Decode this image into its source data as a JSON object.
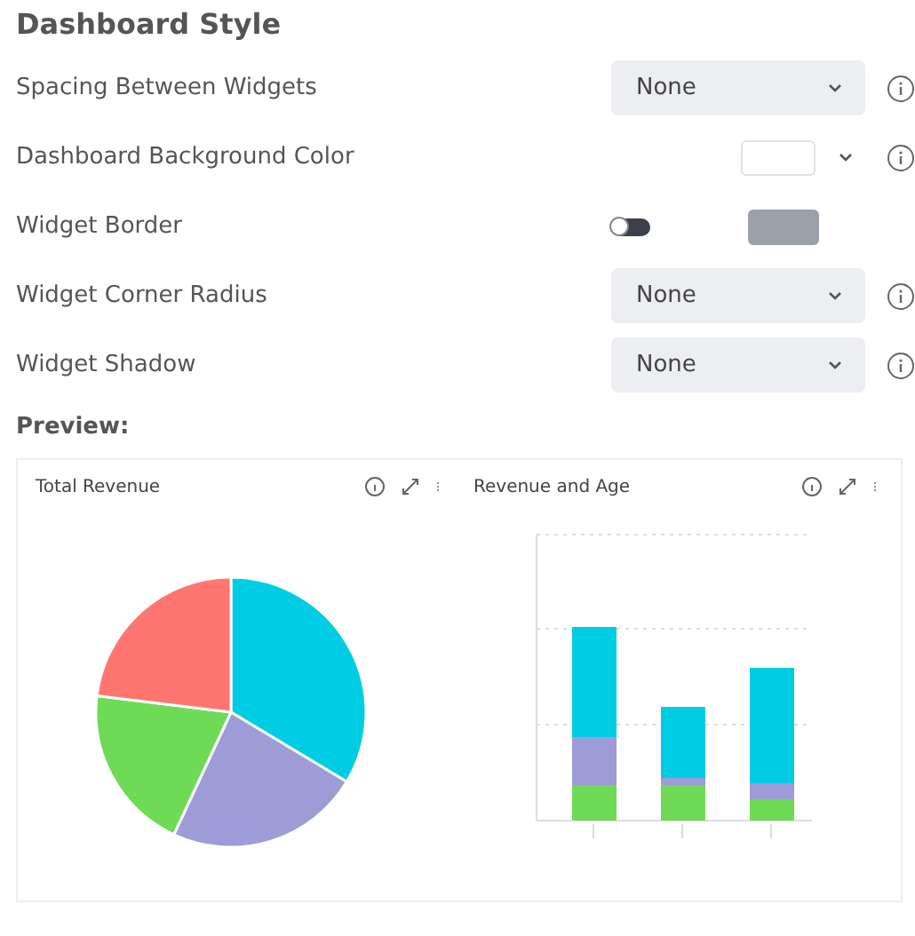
{
  "title": "Dashboard Style",
  "settings": [
    {
      "kind": "select",
      "label": "Spacing Between Widgets",
      "value": "None",
      "info": true
    },
    {
      "kind": "color",
      "label": "Dashboard Background Color",
      "color": "#ffffff",
      "info": true
    },
    {
      "kind": "toggle",
      "label": "Widget Border",
      "on": false,
      "color": "#9ca0a8",
      "info": false
    },
    {
      "kind": "select",
      "label": "Widget Corner Radius",
      "value": "None",
      "info": true
    },
    {
      "kind": "select",
      "label": "Widget Shadow",
      "value": "None",
      "info": true
    }
  ],
  "preview": {
    "label": "Preview:",
    "widgets": [
      {
        "kind": "pie",
        "title": "Total Revenue"
      },
      {
        "kind": "bar",
        "title": "Revenue and Age"
      }
    ]
  }
}
